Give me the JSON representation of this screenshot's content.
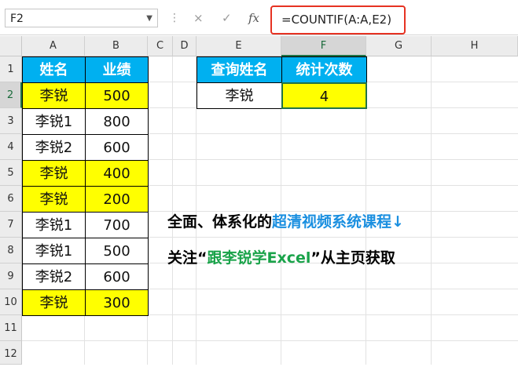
{
  "formula_bar": {
    "name_box": "F2",
    "cancel_glyph": "×",
    "enter_glyph": "✓",
    "fx_label": "fx",
    "formula": "=COUNTIF(A:A,E2)"
  },
  "columns": [
    "A",
    "B",
    "C",
    "D",
    "E",
    "F",
    "G",
    "H"
  ],
  "rows": [
    "1",
    "2",
    "3",
    "4",
    "5",
    "6",
    "7",
    "8",
    "9",
    "10",
    "11",
    "12"
  ],
  "table": {
    "headers": [
      "姓名",
      "业绩"
    ],
    "records": [
      {
        "name": "李锐",
        "score": "500",
        "highlight": true
      },
      {
        "name": "李锐1",
        "score": "800",
        "highlight": false
      },
      {
        "name": "李锐2",
        "score": "600",
        "highlight": false
      },
      {
        "name": "李锐",
        "score": "400",
        "highlight": true
      },
      {
        "name": "李锐",
        "score": "200",
        "highlight": true
      },
      {
        "name": "李锐1",
        "score": "700",
        "highlight": false
      },
      {
        "name": "李锐1",
        "score": "500",
        "highlight": false
      },
      {
        "name": "李锐2",
        "score": "600",
        "highlight": false
      },
      {
        "name": "李锐",
        "score": "300",
        "highlight": true
      }
    ]
  },
  "lookup": {
    "header_name": "查询姓名",
    "header_count": "统计次数",
    "name": "李锐",
    "count": "4"
  },
  "promo": {
    "line1_black": "全面、体系化的",
    "line1_blue": "超清视频系统课程↓",
    "line2_pre": "关注“",
    "line2_green": "跟李锐学Excel",
    "line2_post": "”从主页获取"
  },
  "colors": {
    "header_fill": "#00b0f0",
    "highlight_fill": "#ffff00",
    "formula_border": "#e63222",
    "blue_text": "#1a8fe0",
    "green_text": "#1aa34a"
  }
}
